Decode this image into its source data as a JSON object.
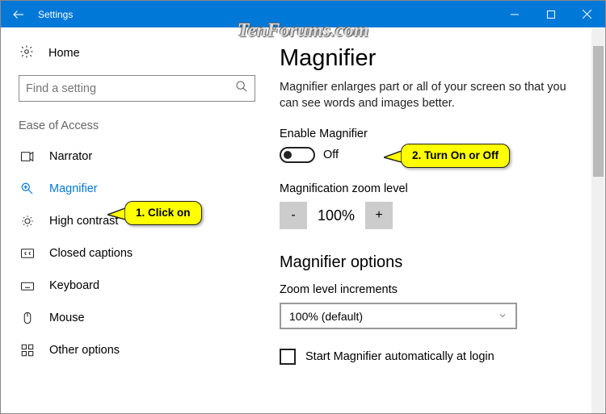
{
  "titlebar": {
    "title": "Settings"
  },
  "sidebar": {
    "home": "Home",
    "search_placeholder": "Find a setting",
    "category": "Ease of Access",
    "items": [
      {
        "label": "Narrator"
      },
      {
        "label": "Magnifier"
      },
      {
        "label": "High contrast"
      },
      {
        "label": "Closed captions"
      },
      {
        "label": "Keyboard"
      },
      {
        "label": "Mouse"
      },
      {
        "label": "Other options"
      }
    ]
  },
  "main": {
    "title": "Magnifier",
    "desc": "Magnifier enlarges part or all of your screen so that you can see words and images better.",
    "enable_label": "Enable Magnifier",
    "toggle_state": "Off",
    "zoom_label": "Magnification zoom level",
    "zoom_minus": "-",
    "zoom_value": "100%",
    "zoom_plus": "+",
    "options_heading": "Magnifier options",
    "increments_label": "Zoom level increments",
    "increments_value": "100% (default)",
    "autostart_label": "Start Magnifier automatically at login"
  },
  "callouts": {
    "c1": "1. Click on",
    "c2": "2. Turn On or Off"
  },
  "watermark": "TenForums.com"
}
